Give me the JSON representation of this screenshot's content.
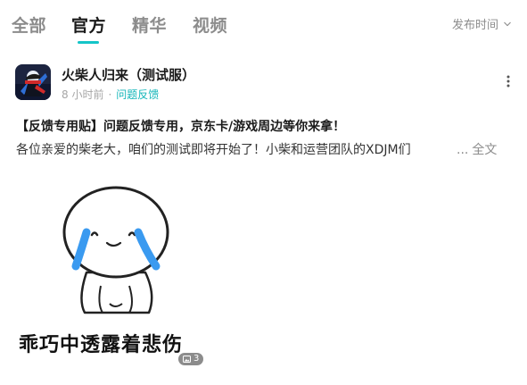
{
  "tabs": [
    {
      "label": "全部"
    },
    {
      "label": "官方"
    },
    {
      "label": "精华"
    },
    {
      "label": "视频"
    }
  ],
  "sort": {
    "label": "发布时间"
  },
  "post": {
    "author": "火柴人归来（测试服）",
    "time": "8 小时前",
    "separator": "·",
    "category": "问题反馈",
    "headline": "【反馈专用贴】问题反馈专用，京东卡/游戏周边等你来拿！",
    "excerpt": "各位亲爱的柴老大，咱们的测试即将开始了！小柴和运营团队的XDJM们",
    "ellipsis": "...",
    "expand": "全文",
    "image": {
      "caption": "乖巧中透露着悲伤",
      "count": "3"
    }
  },
  "colors": {
    "accent": "#14c5c8",
    "category": "#14b6b9",
    "muted": "#8c8c8c"
  }
}
